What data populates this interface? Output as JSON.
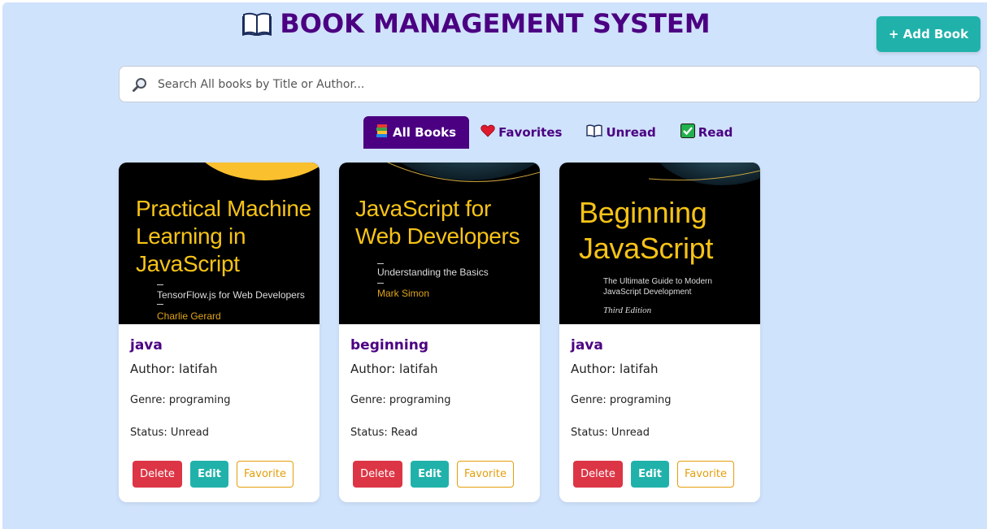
{
  "header": {
    "title": "BOOK MANAGEMENT SYSTEM",
    "title_icon": "open-book-icon",
    "add_button_label": "+ Add Book"
  },
  "search": {
    "placeholder": "Search All books by Title or Author...",
    "value": "",
    "icon": "magnifier-icon"
  },
  "tabs": [
    {
      "label": "All Books",
      "icon": "books-icon",
      "active": true
    },
    {
      "label": "Favorites",
      "icon": "heart-icon",
      "active": false
    },
    {
      "label": "Unread",
      "icon": "open-book-icon",
      "active": false
    },
    {
      "label": "Read",
      "icon": "check-icon",
      "active": false
    }
  ],
  "books": [
    {
      "cover": {
        "title": "Practical Machine\nLearning in\nJavaScript",
        "subtitle": "TensorFlow.js for Web Developers",
        "author": "Charlie Gerard"
      },
      "title": "java",
      "author": "Author: latifah",
      "genre": "Genre: programing",
      "status": "Status: Unread"
    },
    {
      "cover": {
        "title": "JavaScript for\nWeb Developers",
        "subtitle": "Understanding the Basics",
        "author": "Mark Simon"
      },
      "title": "beginning",
      "author": "Author: latifah",
      "genre": "Genre: programing",
      "status": "Status: Read"
    },
    {
      "cover": {
        "title": "Beginning\nJavaScript",
        "subtitle": "The Ultimate Guide to Modern\nJavaScript Development",
        "edition": "Third Edition"
      },
      "title": "java",
      "author": "Author: latifah",
      "genre": "Genre: programing",
      "status": "Status: Unread"
    }
  ],
  "card_actions": {
    "delete_label": "Delete",
    "edit_label": "Edit",
    "favorite_label": "Favorite"
  },
  "colors": {
    "background": "#d0e3fc",
    "brand": "#4b0082",
    "accent": "#20b2aa",
    "danger": "#dc3545",
    "favorite": "#e59e0b",
    "cover_title": "#f7c316"
  }
}
